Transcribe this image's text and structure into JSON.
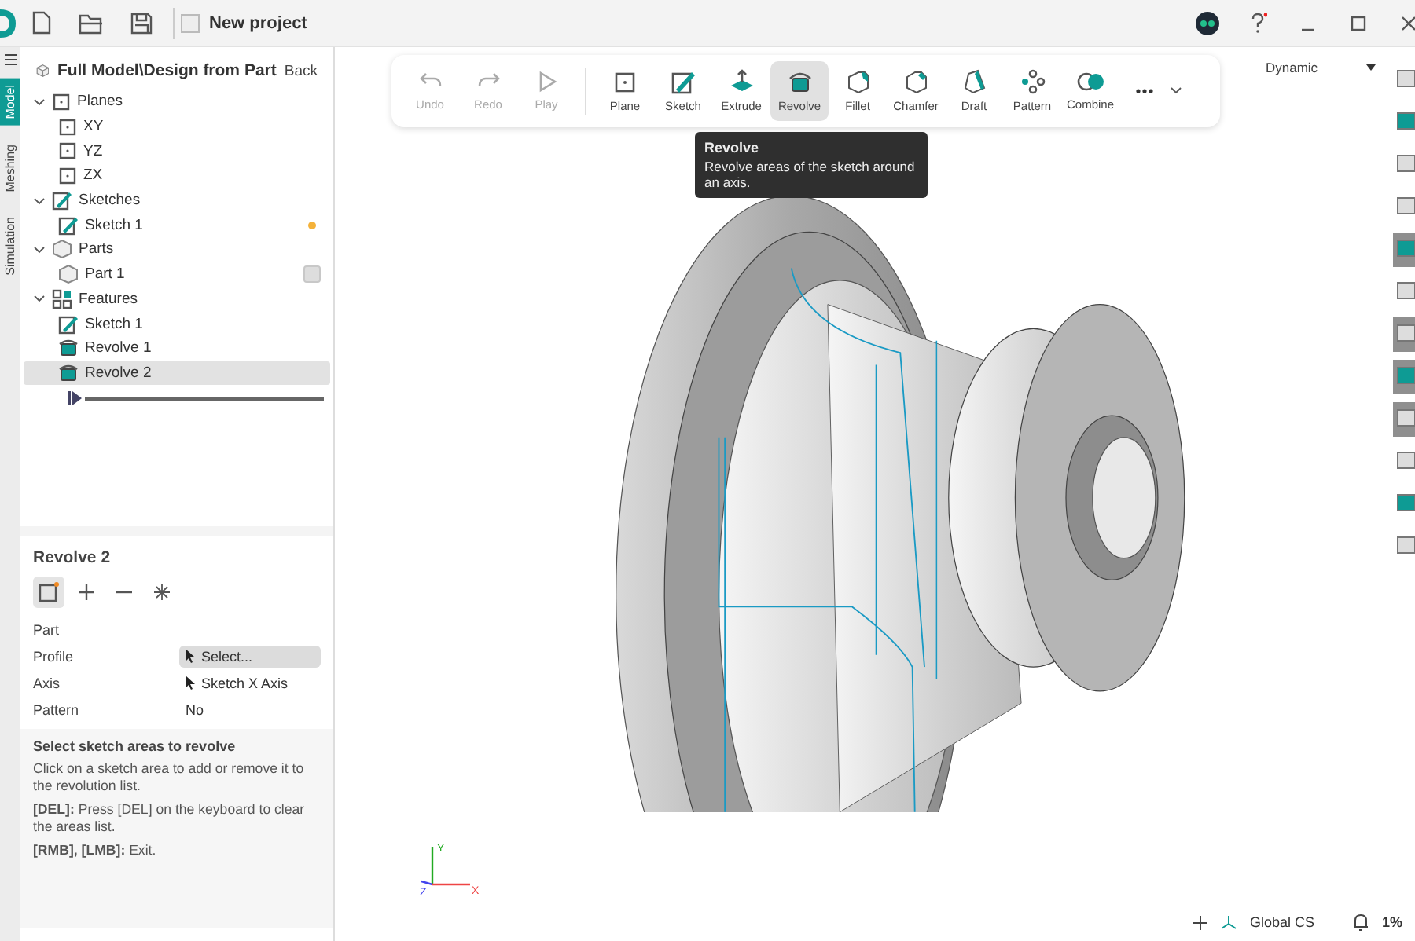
{
  "window": {
    "title": "New project"
  },
  "side_tabs": [
    {
      "label": "Model",
      "selected": true
    },
    {
      "label": "Meshing",
      "selected": false
    },
    {
      "label": "Simulation",
      "selected": false
    }
  ],
  "tree": {
    "title": "Full Model\\Design from Part",
    "back": "Back",
    "items": [
      {
        "label": "Planes",
        "kind": "plane",
        "expanded": true,
        "selected": false,
        "children": [
          {
            "label": "XY",
            "kind": "plane",
            "selected": false
          },
          {
            "label": "YZ",
            "kind": "plane",
            "selected": false
          },
          {
            "label": "ZX",
            "kind": "plane",
            "selected": false
          }
        ]
      },
      {
        "label": "Sketches",
        "kind": "sketch",
        "expanded": true,
        "selected": false,
        "children": [
          {
            "label": "Sketch 1",
            "kind": "sketch",
            "selected": false,
            "modified": true
          }
        ]
      },
      {
        "label": "Parts",
        "kind": "part",
        "expanded": true,
        "selected": false,
        "children": [
          {
            "label": "Part 1",
            "kind": "part",
            "selected": false,
            "checked": false
          }
        ]
      },
      {
        "label": "Features",
        "kind": "features",
        "expanded": true,
        "selected": false,
        "children": [
          {
            "label": "Sketch 1",
            "kind": "sketch",
            "selected": false
          },
          {
            "label": "Revolve 1",
            "kind": "revolve",
            "selected": false
          },
          {
            "label": "Revolve 2",
            "kind": "revolve",
            "selected": true
          }
        ]
      }
    ]
  },
  "properties": {
    "title": "Revolve 2",
    "modes": [
      {
        "kind": "new",
        "selected": true
      },
      {
        "kind": "add",
        "selected": false
      },
      {
        "kind": "subtract",
        "selected": false
      },
      {
        "kind": "intersect",
        "selected": false
      }
    ],
    "rows": [
      {
        "label": "Part",
        "kind": "plain"
      },
      {
        "label": "Profile",
        "value": "Select...",
        "kind": "picker"
      },
      {
        "label": "Axis",
        "value": "Sketch X Axis",
        "kind": "pick"
      },
      {
        "label": "Pattern",
        "value": "No",
        "kind": "plain"
      }
    ],
    "help": {
      "title": "Select sketch areas to revolve",
      "lines": [
        "Click on a sketch area to add or remove it to the revolution list.",
        "**[DEL]:**  Press [DEL] on the keyboard to clear the areas list.",
        "**[RMB], [LMB]:** Exit."
      ]
    }
  },
  "toolbar": [
    {
      "label": "Undo",
      "kind": "undo",
      "disabled": true,
      "selected": false
    },
    {
      "label": "Redo",
      "kind": "redo",
      "disabled": true,
      "selected": false
    },
    {
      "label": "Play",
      "kind": "play",
      "disabled": true,
      "selected": false
    },
    {
      "label": "Plane",
      "kind": "plane",
      "disabled": false,
      "selected": false
    },
    {
      "label": "Sketch",
      "kind": "sketch",
      "disabled": false,
      "selected": false
    },
    {
      "label": "Extrude",
      "kind": "extrude",
      "disabled": false,
      "selected": false
    },
    {
      "label": "Revolve",
      "kind": "revolve",
      "disabled": false,
      "selected": true
    },
    {
      "label": "Fillet",
      "kind": "fillet",
      "disabled": false,
      "selected": false
    },
    {
      "label": "Chamfer",
      "kind": "chamfer",
      "disabled": false,
      "selected": false
    },
    {
      "label": "Draft",
      "kind": "draft",
      "disabled": false,
      "selected": false
    },
    {
      "label": "Pattern",
      "kind": "pattern",
      "disabled": false,
      "selected": false
    },
    {
      "label": "Combine",
      "kind": "combine",
      "disabled": false,
      "selected": false
    }
  ],
  "tooltip": {
    "title": "Revolve",
    "text": "Revolve areas of the sketch around an axis."
  },
  "view_mode": "Dynamic",
  "axis_labels": {
    "y": "Y",
    "z": "Z",
    "x": "X"
  },
  "status_bar": {
    "coordinate_system": "Global CS",
    "percent": "1%"
  }
}
